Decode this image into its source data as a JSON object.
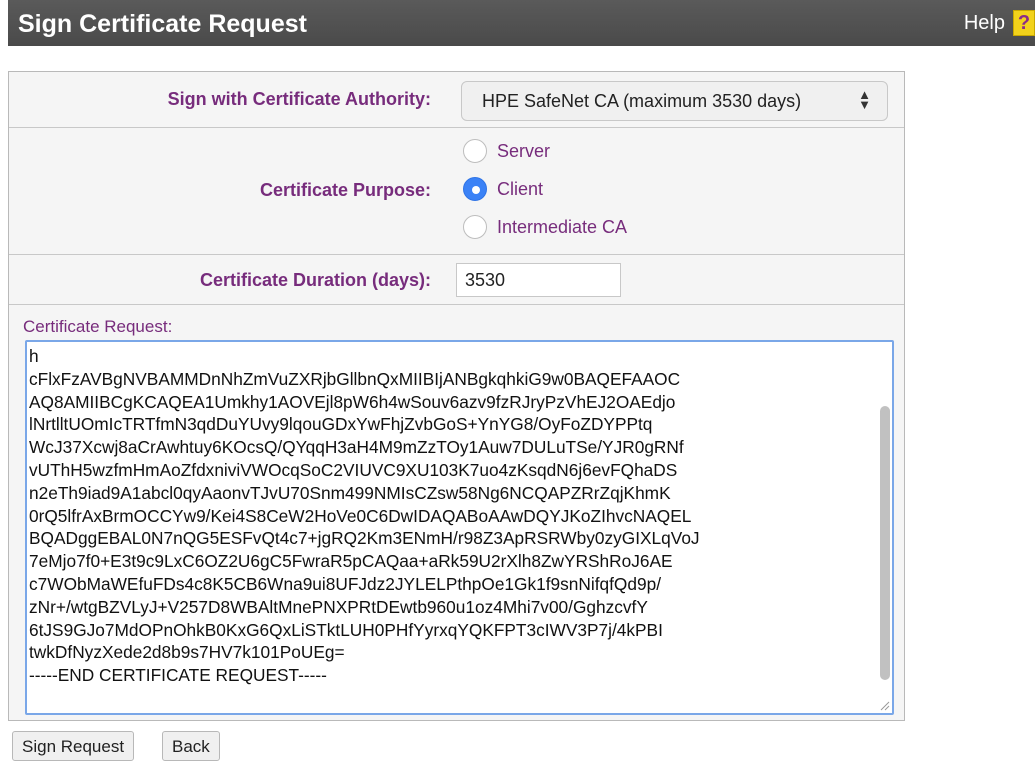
{
  "header": {
    "title": "Sign Certificate Request",
    "help_label": "Help",
    "help_icon": "?"
  },
  "form": {
    "ca_label": "Sign with Certificate Authority:",
    "ca_selected": "HPE SafeNet CA (maximum 3530 days)",
    "purpose_label": "Certificate Purpose:",
    "purpose_options": [
      "Server",
      "Client",
      "Intermediate CA"
    ],
    "purpose_selected": "Client",
    "duration_label": "Certificate Duration (days):",
    "duration_value": "3530",
    "request_label": "Certificate Request:",
    "request_text": "h\ncFlxFzAVBgNVBAMMDnNhZmVuZXRjbGllbnQxMIIBIjANBgkqhkiG9w0BAQEFAAOC\nAQ8AMIIBCgKCAQEA1Umkhy1AOVEjl8pW6h4wSouv6azv9fzRJryPzVhEJ2OAEdjo\nlNrtlltUOmIcTRTfmN3qdDuYUvy9lqouGDxYwFhjZvbGoS+YnYG8/OyFoZDYPPtq\nWcJ37Xcwj8aCrAwhtuy6KOcsQ/QYqqH3aH4M9mZzTOy1Auw7DULuTSe/YJR0gRNf\nvUThH5wzfmHmAoZfdxniviVWOcqSoC2VIUVC9XU103K7uo4zKsqdN6j6evFQhaDS\nn2eTh9iad9A1abcl0qyAaonvTJvU70Snm499NMIsCZsw58Ng6NCQAPZRrZqjKhmK\n0rQ5lfrAxBrmOCCYw9/Kei4S8CeW2HoVe0C6DwIDAQABoAAwDQYJKoZIhvcNAQEL\nBQADggEBAL0N7nQG5ESFvQt4c7+jgRQ2Km3ENmH/r98Z3ApRSRWby0zyGIXLqVoJ\n7eMjo7f0+E3t9c9LxC6OZ2U6gC5FwraR5pCAQaa+aRk59U2rXlh8ZwYRShRoJ6AE\nc7WObMaWEfuFDs4c8K5CB6Wna9ui8UFJdz2JYLELPthpOe1Gk1f9snNifqfQd9p/\nzNr+/wtgBZVLyJ+V257D8WBAltMnePNXPRtDEwtb960u1oz4Mhi7v00/GghzcvfY\n6tJS9GJo7MdOPnOhkB0KxG6QxLiSTktLUH0PHfYyrxqYQKFPT3cIWV3P7j/4kPBI\ntwkDfNyzXede2d8b9s7HV7k101PoUEg=\n-----END CERTIFICATE REQUEST-----"
  },
  "buttons": {
    "sign_label": "Sign Request",
    "back_label": "Back"
  },
  "colors": {
    "header_bg": "#4f4f4f",
    "label_purple": "#772c7c",
    "radio_selected": "#3b82f6",
    "focus_border": "#7aa7e8"
  }
}
